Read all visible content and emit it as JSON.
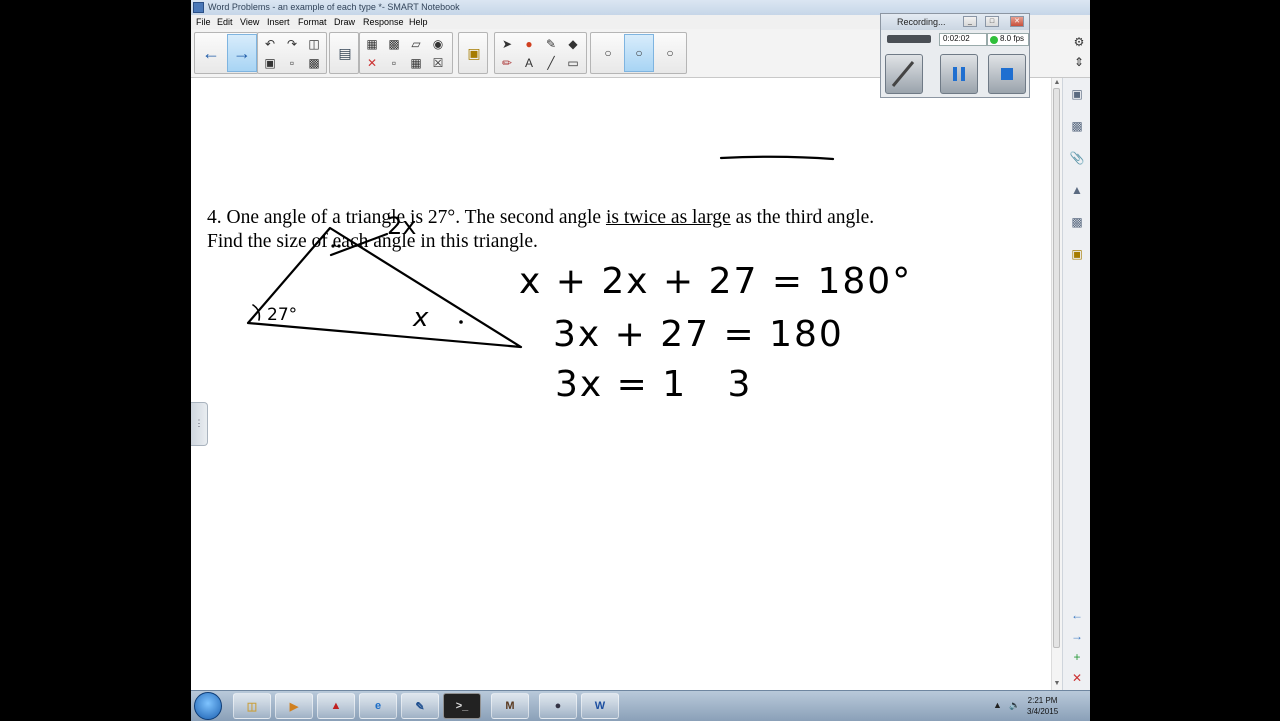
{
  "window": {
    "title": "Word Problems - an example of each type *- SMART Notebook"
  },
  "menu": [
    "File",
    "Edit",
    "View",
    "Insert",
    "Format",
    "Draw",
    "Response",
    "Help"
  ],
  "toolbar": {
    "nav": [
      "back-arrow-icon",
      "forward-arrow-icon"
    ],
    "tools": [
      "undo-icon",
      "redo-icon",
      "open-icon",
      "screen-shade-icon",
      "paste-icon",
      "screen-capture-icon",
      "table-icon",
      "add-page-icon",
      "delete-icon",
      "save-icon",
      "cut-icon",
      "document-camera-icon",
      "close-icon",
      "select-icon",
      "fill-icon",
      "pen-icon",
      "magic-pen-icon",
      "creative-pen-icon",
      "text-icon",
      "line-icon",
      "eraser-icon",
      "pen-style-1-icon",
      "pen-style-2-icon",
      "pen-style-3-icon"
    ]
  },
  "problem": {
    "line1_a": "4.  One angle of a triangle is 27°.  The second angle ",
    "line1_b": "is twice as large",
    "line1_c": " as the third angle.",
    "line2": "Find the size of each angle in this triangle."
  },
  "handwriting": {
    "label_2x": "2x",
    "label_27": "27°",
    "label_x": "x",
    "eq1": "x + 2x + 27 = 180°",
    "eq2": "3x + 27 = 180",
    "eq3": "3x = 1   3"
  },
  "recorder": {
    "title": "Recording...",
    "time": "0:02:02",
    "fps": "8.0 fps",
    "status_color": "#2fbf3a"
  },
  "taskbar": {
    "time": "2:21 PM",
    "date": "3/4/2015"
  },
  "colors": {
    "ink": "#000000",
    "active_tool": "#a8d4f4"
  }
}
